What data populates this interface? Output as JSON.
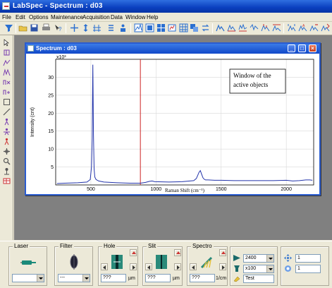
{
  "window": {
    "title": "LabSpec - Spectrum : d03"
  },
  "menu": [
    "File",
    "Edit",
    "Options",
    "Maintenance",
    "Acquisition",
    "Data",
    "Window",
    "Help"
  ],
  "child": {
    "title": "Spectrum : d03",
    "annotation_line1": "Window  of  the",
    "annotation_line2": "active objects"
  },
  "chart_data": {
    "type": "line",
    "title": "",
    "xlabel": "Raman Shift (cm⁻¹)",
    "ylabel": "Intensity (cnt)",
    "y_multiplier": "x10³",
    "xlim": [
      230,
      2210
    ],
    "ylim": [
      0,
      35
    ],
    "x_ticks": [
      500,
      1000,
      1500,
      2000
    ],
    "y_ticks": [
      5,
      10,
      15,
      20,
      25,
      30
    ],
    "grid": true,
    "series": [
      {
        "color": "#2233aa",
        "x": [
          240,
          300,
          400,
          470,
          495,
          505,
          510,
          515,
          520,
          525,
          530,
          540,
          560,
          600,
          700,
          800,
          880,
          920,
          950,
          970,
          990,
          1100,
          1200,
          1290,
          1310,
          1330,
          1340,
          1350,
          1360,
          1370,
          1380,
          1400,
          1450,
          1500,
          1600,
          1700,
          1800,
          1900,
          2000,
          2050,
          2100,
          2150,
          2180,
          2200
        ],
        "y": [
          0.4,
          0.5,
          0.6,
          0.8,
          1.5,
          5.0,
          13.0,
          33.5,
          14.0,
          4.5,
          2.2,
          1.5,
          1.1,
          0.8,
          0.6,
          0.5,
          0.5,
          0.7,
          1.0,
          1.1,
          0.9,
          0.8,
          0.9,
          1.2,
          1.8,
          3.5,
          4.0,
          3.0,
          2.0,
          1.6,
          1.4,
          1.4,
          1.3,
          1.3,
          1.2,
          1.2,
          1.2,
          1.2,
          1.3,
          1.1,
          1.2,
          1.4,
          1.4,
          1.3
        ]
      }
    ],
    "cursor_x": 880,
    "cursor_color": "#cc2222"
  },
  "panel": {
    "laser": {
      "label": "Laser",
      "value": ""
    },
    "filter": {
      "label": "Filter",
      "value": "---"
    },
    "hole": {
      "label": "Hole",
      "value": "???",
      "unit": "µm"
    },
    "slit": {
      "label": "Slit",
      "value": "???",
      "unit": "µm"
    },
    "spectro": {
      "label": "Spectro",
      "value": "???",
      "unit": "1/cm"
    },
    "grating": "2400",
    "objective": "x100",
    "test": "Test",
    "field1": "1",
    "field2": "1"
  }
}
